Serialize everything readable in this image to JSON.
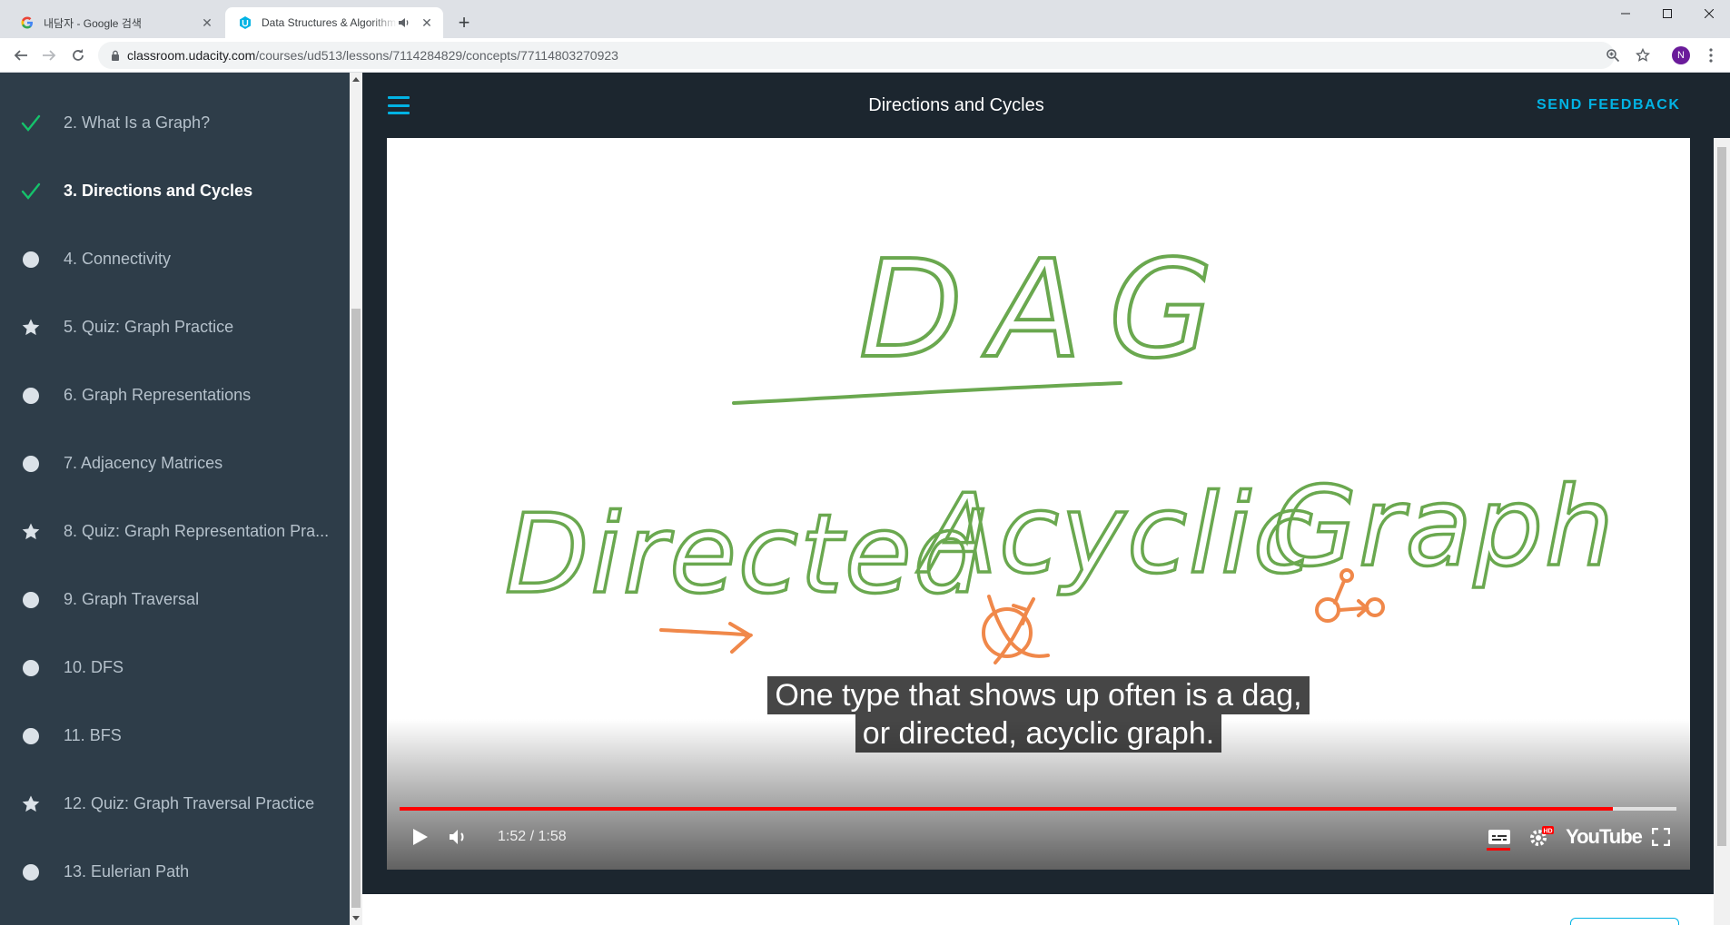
{
  "browser": {
    "tabs": [
      {
        "title": "내담자 - Google 검색",
        "favicon": "google-g-icon",
        "active": false
      },
      {
        "title": "Data Structures & Algorithms",
        "favicon": "udacity-icon",
        "active": true,
        "audio": true
      }
    ],
    "url": {
      "host": "classroom.udacity.com",
      "path": "/courses/ud513/lessons/7114284829/concepts/77114803270923"
    },
    "profile_initial": "N"
  },
  "sidebar": {
    "items": [
      {
        "label": "2. What Is a Graph?",
        "status": "check"
      },
      {
        "label": "3. Directions and Cycles",
        "status": "check",
        "current": true
      },
      {
        "label": "4. Connectivity",
        "status": "dot"
      },
      {
        "label": "5. Quiz: Graph Practice",
        "status": "star"
      },
      {
        "label": "6. Graph Representations",
        "status": "dot"
      },
      {
        "label": "7. Adjacency Matrices",
        "status": "dot"
      },
      {
        "label": "8. Quiz: Graph Representation Pra...",
        "status": "star"
      },
      {
        "label": "9. Graph Traversal",
        "status": "dot"
      },
      {
        "label": "10. DFS",
        "status": "dot"
      },
      {
        "label": "11. BFS",
        "status": "dot"
      },
      {
        "label": "12. Quiz: Graph Traversal Practice",
        "status": "star"
      },
      {
        "label": "13. Eulerian Path",
        "status": "dot"
      }
    ]
  },
  "header": {
    "title": "Directions and Cycles",
    "feedback": "SEND FEEDBACK"
  },
  "video": {
    "board_title": "DAG",
    "board_words": [
      "Directed",
      "Acyclic",
      "Graph"
    ],
    "captions": [
      "One type that shows up often is a dag,",
      "or directed, acyclic graph."
    ],
    "time": "1:52 / 1:58",
    "played_fraction": 0.95,
    "logo": "YouTube",
    "hd_badge": "HD"
  },
  "colors": {
    "accent": "#02b3e4",
    "sidebar_bg": "#2e3d49",
    "check": "#15c26b",
    "progress": "#ff0000",
    "ink_green": "#6aa84f",
    "ink_orange": "#f0884a"
  }
}
